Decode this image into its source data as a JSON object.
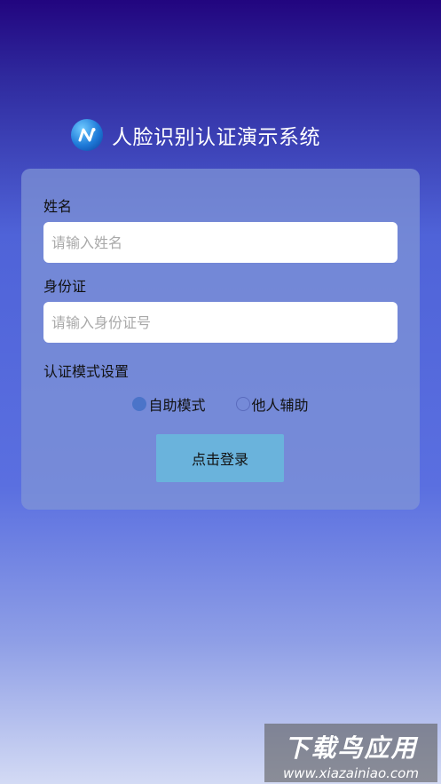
{
  "header": {
    "title": "人脸识别认证演示系统",
    "logo_icon": "app-logo-icon"
  },
  "form": {
    "name_label": "姓名",
    "name_placeholder": "请输入姓名",
    "name_value": "",
    "id_label": "身份证",
    "id_placeholder": "请输入身份证号",
    "id_value": "",
    "mode_label": "认证模式设置",
    "mode_options": [
      {
        "label": "自助模式",
        "selected": true
      },
      {
        "label": "他人辅助",
        "selected": false
      }
    ],
    "login_label": "点击登录"
  },
  "watermark": {
    "main": "下载鸟应用",
    "sub": "www.xiazainiao.com"
  },
  "colors": {
    "button": "#6ab3dc",
    "radio_selected": "#4b74c9",
    "card": "#8196d6"
  }
}
